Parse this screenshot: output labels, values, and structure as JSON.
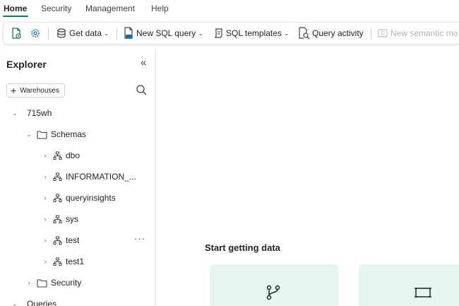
{
  "menu": {
    "items": [
      {
        "label": "Home"
      },
      {
        "label": "Security"
      },
      {
        "label": "Management"
      },
      {
        "label": "Help"
      }
    ]
  },
  "toolbar": {
    "get_data": "Get data",
    "new_sql_query": "New SQL query",
    "sql_templates": "SQL templates",
    "query_activity": "Query activity",
    "new_semantic_model": "New semantic mo"
  },
  "explorer": {
    "title": "Explorer",
    "add_warehouses": "Warehouses",
    "tree": {
      "warehouse": "715wh",
      "schemas": "Schemas",
      "schema_items": [
        "dbo",
        "INFORMATION_...",
        "queryinsights",
        "sys",
        "test",
        "test1"
      ],
      "security": "Security",
      "queries": "Queries"
    }
  },
  "main": {
    "start_title": "Start getting data"
  },
  "colors": {
    "accent": "#117865",
    "card_bg": "#e6f5ef",
    "icon_green": "#117865",
    "icon_blue": "#0f6cbd"
  }
}
